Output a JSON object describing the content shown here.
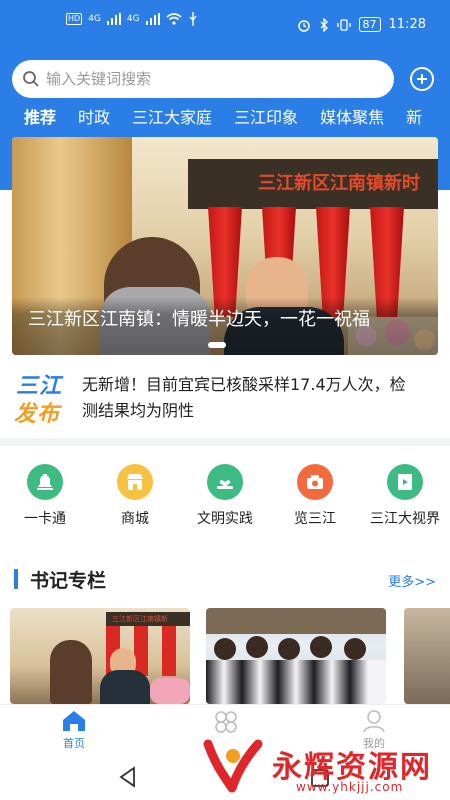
{
  "status_bar": {
    "left_badges": [
      "HD",
      "4G",
      "4G"
    ],
    "battery": "87",
    "time": "11:28"
  },
  "search": {
    "placeholder": "输入关键词搜索"
  },
  "tabs": [
    "推荐",
    "时政",
    "三江大家庭",
    "三江印象",
    "媒体聚焦",
    "新"
  ],
  "banner": {
    "sign_text": "三江新区江南镇新时",
    "caption": "三江新区江南镇：情暖半边天，一花一祝福"
  },
  "ticker": {
    "logo_line1": "三江",
    "logo_line2": "发布",
    "text": "无新增！目前宜宾已核酸采样17.4万人次，检测结果均为阴性"
  },
  "shortcuts": [
    {
      "label": "一卡通",
      "icon": "bell-icon",
      "color": "#3dbb82"
    },
    {
      "label": "商城",
      "icon": "shop-icon",
      "color": "#f5c242"
    },
    {
      "label": "文明实践",
      "icon": "heart-hand-icon",
      "color": "#3dbb82"
    },
    {
      "label": "览三江",
      "icon": "camera-icon",
      "color": "#f26a3d"
    },
    {
      "label": "三江大视界",
      "icon": "film-icon",
      "color": "#3dbb82"
    }
  ],
  "section": {
    "title": "书记专栏",
    "more": "更多>>",
    "thumb_sign": "三江新区江南镇新"
  },
  "bottom_nav": {
    "home": "首页",
    "mine": "我的"
  },
  "watermark": {
    "name": "永辉资源网",
    "url": "www.yhkjjj.com"
  },
  "colors": {
    "brand_blue": "#2a7ee6",
    "watermark_red": "#e0262a"
  }
}
